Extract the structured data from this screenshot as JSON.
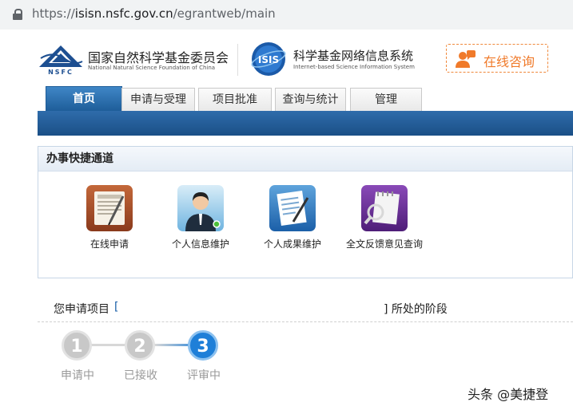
{
  "browser": {
    "url_scheme": "https://",
    "url_host": "isisn.nsfc.gov.cn",
    "url_path": "/egrantweb/main"
  },
  "header": {
    "org_name_cn": "国家自然科学基金委员会",
    "org_name_en": "National Natural Science Foundation of China",
    "org_logo_text": "NSFC",
    "system_logo_text": "ISIS",
    "system_name_cn": "科学基金网络信息系统",
    "system_name_en": "Internet-based Science Information System",
    "consult_label": "在线咨询"
  },
  "nav": {
    "tabs": [
      {
        "label": "首页",
        "active": true
      },
      {
        "label": "申请与受理",
        "active": false
      },
      {
        "label": "项目批准",
        "active": false
      },
      {
        "label": "查询与统计",
        "active": false
      },
      {
        "label": "管理",
        "active": false
      }
    ]
  },
  "quick": {
    "title": "办事快捷通道",
    "items": [
      {
        "label": "在线申请",
        "icon": "online-application-icon"
      },
      {
        "label": "个人信息维护",
        "icon": "personal-info-icon"
      },
      {
        "label": "个人成果维护",
        "icon": "personal-achievements-icon"
      },
      {
        "label": "全文反馈意见查询",
        "icon": "feedback-query-icon"
      }
    ]
  },
  "application": {
    "label_prefix": "您申请项目",
    "bracket_open": "[",
    "bracket_close": "]",
    "label_suffix": "所处的阶段"
  },
  "progress": {
    "steps": [
      {
        "number": "1",
        "label": "申请中",
        "state": "done"
      },
      {
        "number": "2",
        "label": "已接收",
        "state": "done"
      },
      {
        "number": "3",
        "label": "评审中",
        "state": "current"
      }
    ]
  },
  "watermark": "头条 @美捷登",
  "colors": {
    "nav_blue": "#1d5c98",
    "accent_orange": "#f07a2a",
    "current_step_blue": "#1e7fd8"
  }
}
